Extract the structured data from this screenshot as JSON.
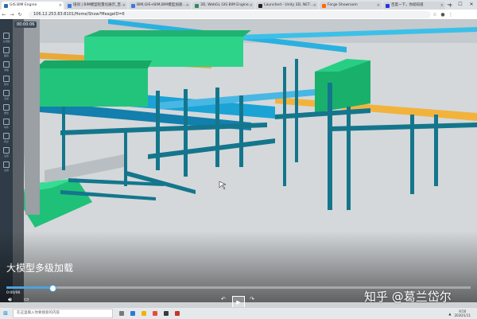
{
  "browser": {
    "tabs": [
      {
        "label": "GIS BIM Engine",
        "active": true,
        "color": "#2b6cb0"
      },
      {
        "label": "培训 | BIM模型轻量化展示_百…",
        "active": false,
        "color": "#3a7bd5"
      },
      {
        "label": "BIM,GIS+BIM,BIM模型加速…",
        "active": false,
        "color": "#3a7bd5"
      },
      {
        "label": "3D, WebGL GIS BIM Engine…",
        "active": false,
        "color": "#2e8b57"
      },
      {
        "label": "Launched - Unity 3D, NET…",
        "active": false,
        "color": "#222222"
      },
      {
        "label": "Forge Showroom",
        "active": false,
        "color": "#ff6a00"
      },
      {
        "label": "百度一下，你就知道",
        "active": false,
        "color": "#2932e1"
      }
    ],
    "new_tab": "+",
    "url": "106.12.253.83:8101/Home/Show?MeageID=6"
  },
  "sidebar": {
    "items": [
      {
        "label": "主视图",
        "icon": "home-icon"
      },
      {
        "label": "图层",
        "icon": "layers-icon"
      },
      {
        "label": "测量",
        "icon": "ruler-icon"
      },
      {
        "label": "剖切",
        "icon": "cube-icon"
      },
      {
        "label": "漫游",
        "icon": "walk-icon"
      },
      {
        "label": "属性",
        "icon": "info-icon"
      },
      {
        "label": "构件",
        "icon": "tree-icon"
      },
      {
        "label": "视点",
        "icon": "camera-icon"
      },
      {
        "label": "设置",
        "icon": "gear-icon"
      },
      {
        "label": "全屏",
        "icon": "fullscreen-icon"
      }
    ]
  },
  "viewer": {
    "timer": "00:00:06"
  },
  "video": {
    "caption": "大模型多级加载",
    "elapsed": "0:00/06",
    "progress": 0.1
  },
  "watermark": "知乎 @葛兰岱尔",
  "taskbar": {
    "search_placeholder": "在这里输入你要搜索的内容",
    "time": "9:50",
    "date": "2020/1/11"
  }
}
